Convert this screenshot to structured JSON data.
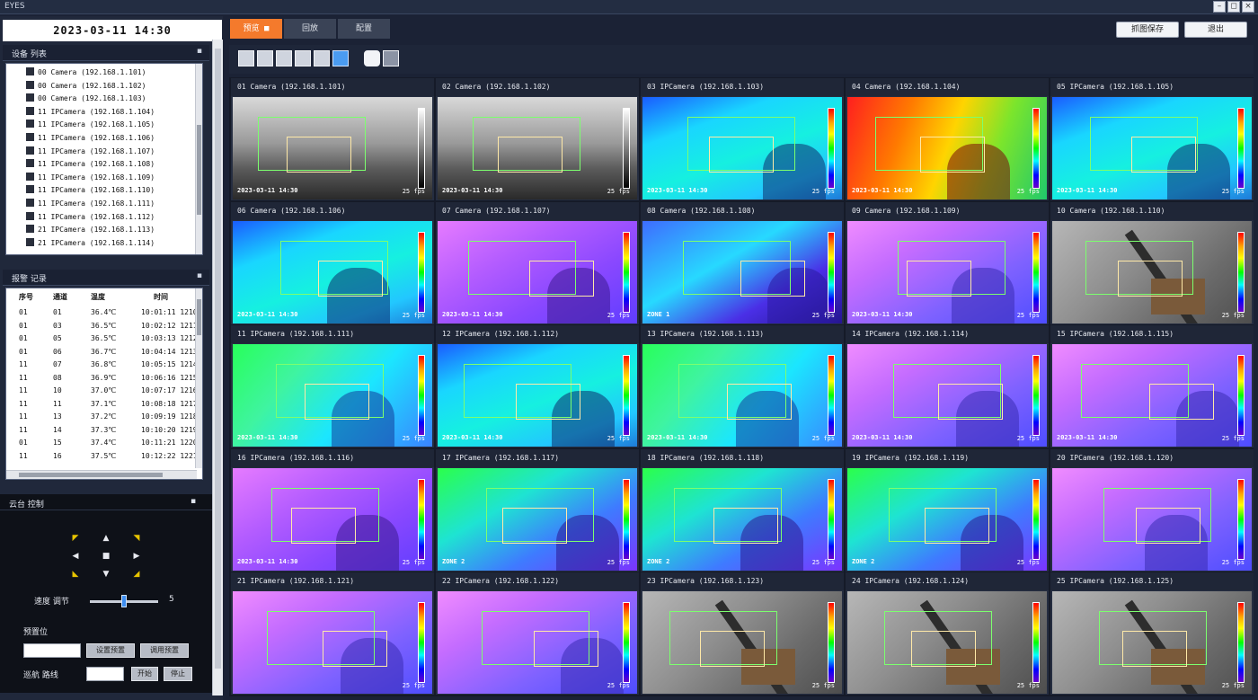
{
  "window": {
    "title": "EYES",
    "min_label": "–",
    "max_label": "◻",
    "close_label": "×"
  },
  "datetime": "2023-03-11 14:30",
  "tabs": [
    {
      "label": "预览 ■",
      "active": true
    },
    {
      "label": "回放",
      "active": false
    },
    {
      "label": "配置",
      "active": false
    }
  ],
  "top_buttons": [
    {
      "label": "抓图保存"
    },
    {
      "label": "退出"
    }
  ],
  "device_panel": {
    "title": "设备 列表",
    "collapse": "▪",
    "items": [
      "00  Camera (192.168.1.101)",
      "00  Camera (192.168.1.102)",
      "00  Camera (192.168.1.103)",
      "11  IPCamera (192.168.1.104)",
      "11  IPCamera (192.168.1.105)",
      "11  IPCamera (192.168.1.106)",
      "11  IPCamera (192.168.1.107)",
      "11  IPCamera (192.168.1.108)",
      "11  IPCamera (192.168.1.109)",
      "11  IPCamera (192.168.1.110)",
      "11  IPCamera (192.168.1.111)",
      "11  IPCamera (192.168.1.112)",
      "21  IPCamera (192.168.1.113)",
      "21  IPCamera (192.168.1.114)"
    ]
  },
  "record_panel": {
    "title": "报警 记录",
    "collapse": "▪",
    "headers": [
      "序号",
      "通道",
      "温度",
      "时间"
    ],
    "rows": [
      [
        "01",
        "01",
        "36.4℃",
        "10:01:11 1210"
      ],
      [
        "01",
        "03",
        "36.5℃",
        "10:02:12 1211"
      ],
      [
        "01",
        "05",
        "36.5℃",
        "10:03:13 1212"
      ],
      [
        "01",
        "06",
        "36.7℃",
        "10:04:14 1213"
      ],
      [
        "11",
        "07",
        "36.8℃",
        "10:05:15 1214"
      ],
      [
        "11",
        "08",
        "36.9℃",
        "10:06:16 1215"
      ],
      [
        "11",
        "10",
        "37.0℃",
        "10:07:17 1216"
      ],
      [
        "11",
        "11",
        "37.1℃",
        "10:08:18 1217"
      ],
      [
        "11",
        "13",
        "37.2℃",
        "10:09:19 1218"
      ],
      [
        "11",
        "14",
        "37.3℃",
        "10:10:20 1219"
      ],
      [
        "01",
        "15",
        "37.4℃",
        "10:11:21 1220"
      ],
      [
        "11",
        "16",
        "37.5℃",
        "10:12:22 1221"
      ]
    ]
  },
  "ptz_panel": {
    "title": "云台 控制",
    "collapse": "▪",
    "speed_label": "速度 调节",
    "speed_value": "5",
    "speed_level": 0.5,
    "preset_title": "预置位",
    "btn_set": "设置预置",
    "btn_call": "调用预置",
    "cruise_label": "巡航 路线",
    "btn_start": "开始",
    "btn_stop": "停止"
  },
  "tiles": [
    {
      "caption": "01  Camera (192.168.1.101)",
      "scheme": "gray",
      "stamp": "2023-03-11 14:30",
      "rate": "25 fps"
    },
    {
      "caption": "02  Camera (192.168.1.102)",
      "scheme": "gray",
      "stamp": "2023-03-11 14:30",
      "rate": "25 fps"
    },
    {
      "caption": "03  IPCamera (192.168.1.103)",
      "scheme": "cyan",
      "stamp": "2023-03-11 14:30",
      "rate": "25 fps"
    },
    {
      "caption": "04  Camera (192.168.1.104)",
      "scheme": "hot",
      "stamp": "2023-03-11 14:30",
      "rate": "25 fps"
    },
    {
      "caption": "05  IPCamera (192.168.1.105)",
      "scheme": "cyan",
      "stamp": "2023-03-11 14:30",
      "rate": "25 fps"
    },
    {
      "caption": "06  Camera (192.168.1.106)",
      "scheme": "cyan",
      "stamp": "2023-03-11 14:30",
      "rate": "25 fps"
    },
    {
      "caption": "07  Camera (192.168.1.107)",
      "scheme": "purple",
      "stamp": "2023-03-11 14:30",
      "rate": "25 fps"
    },
    {
      "caption": "08  Camera (192.168.1.108)",
      "scheme": "blue",
      "stamp": "ZONE 1",
      "rate": "25 fps"
    },
    {
      "caption": "09  Camera (192.168.1.109)",
      "scheme": "violet",
      "stamp": "2023-03-11 14:30",
      "rate": "25 fps"
    },
    {
      "caption": "10  Camera (192.168.1.110)",
      "scheme": "photo",
      "stamp": "",
      "rate": "25 fps"
    },
    {
      "caption": "11  IPCamera (192.168.1.111)",
      "scheme": "green",
      "stamp": "2023-03-11 14:30",
      "rate": "25 fps"
    },
    {
      "caption": "12  IPCamera (192.168.1.112)",
      "scheme": "cyan",
      "stamp": "2023-03-11 14:30",
      "rate": "25 fps"
    },
    {
      "caption": "13  IPCamera (192.168.1.113)",
      "scheme": "green",
      "stamp": "2023-03-11 14:30",
      "rate": "25 fps"
    },
    {
      "caption": "14  IPCamera (192.168.1.114)",
      "scheme": "violet",
      "stamp": "2023-03-11 14:30",
      "rate": "25 fps"
    },
    {
      "caption": "15  IPCamera (192.168.1.115)",
      "scheme": "violet",
      "stamp": "2023-03-11 14:30",
      "rate": "25 fps"
    },
    {
      "caption": "16  IPCamera (192.168.1.116)",
      "scheme": "purple",
      "stamp": "2023-03-11 14:30",
      "rate": "25 fps"
    },
    {
      "caption": "17  IPCamera (192.168.1.117)",
      "scheme": "green2",
      "stamp": "ZONE 2",
      "rate": "25 fps"
    },
    {
      "caption": "18  IPCamera (192.168.1.118)",
      "scheme": "green2",
      "stamp": "ZONE 2",
      "rate": "25 fps"
    },
    {
      "caption": "19  IPCamera (192.168.1.119)",
      "scheme": "green2",
      "stamp": "ZONE 2",
      "rate": "25 fps"
    },
    {
      "caption": "20  IPCamera (192.168.1.120)",
      "scheme": "violet",
      "stamp": "",
      "rate": "25 fps"
    },
    {
      "caption": "21  IPCamera (192.168.1.121)",
      "scheme": "violet",
      "stamp": "",
      "rate": "25 fps"
    },
    {
      "caption": "22  IPCamera (192.168.1.122)",
      "scheme": "violet",
      "stamp": "",
      "rate": "25 fps"
    },
    {
      "caption": "23  IPCamera (192.168.1.123)",
      "scheme": "photo",
      "stamp": "",
      "rate": "25 fps"
    },
    {
      "caption": "24  IPCamera (192.168.1.124)",
      "scheme": "photo",
      "stamp": "",
      "rate": "25 fps"
    },
    {
      "caption": "25  IPCamera (192.168.1.125)",
      "scheme": "photo",
      "stamp": "",
      "rate": "25 fps"
    }
  ],
  "colors": {
    "accent": "#f47a2c",
    "layout_active": "#4a9bf0",
    "alarm": "#ff5a4d",
    "panel_bg": "#20283b"
  },
  "icons": {
    "layouts": [
      "grid-1x1-icon",
      "grid-2x2-icon",
      "grid-3x3-icon",
      "grid-4x4-icon",
      "grid-5x5-icon",
      "fullscreen-icon"
    ],
    "extra": [
      "record-icon",
      "monitor-icon"
    ]
  }
}
